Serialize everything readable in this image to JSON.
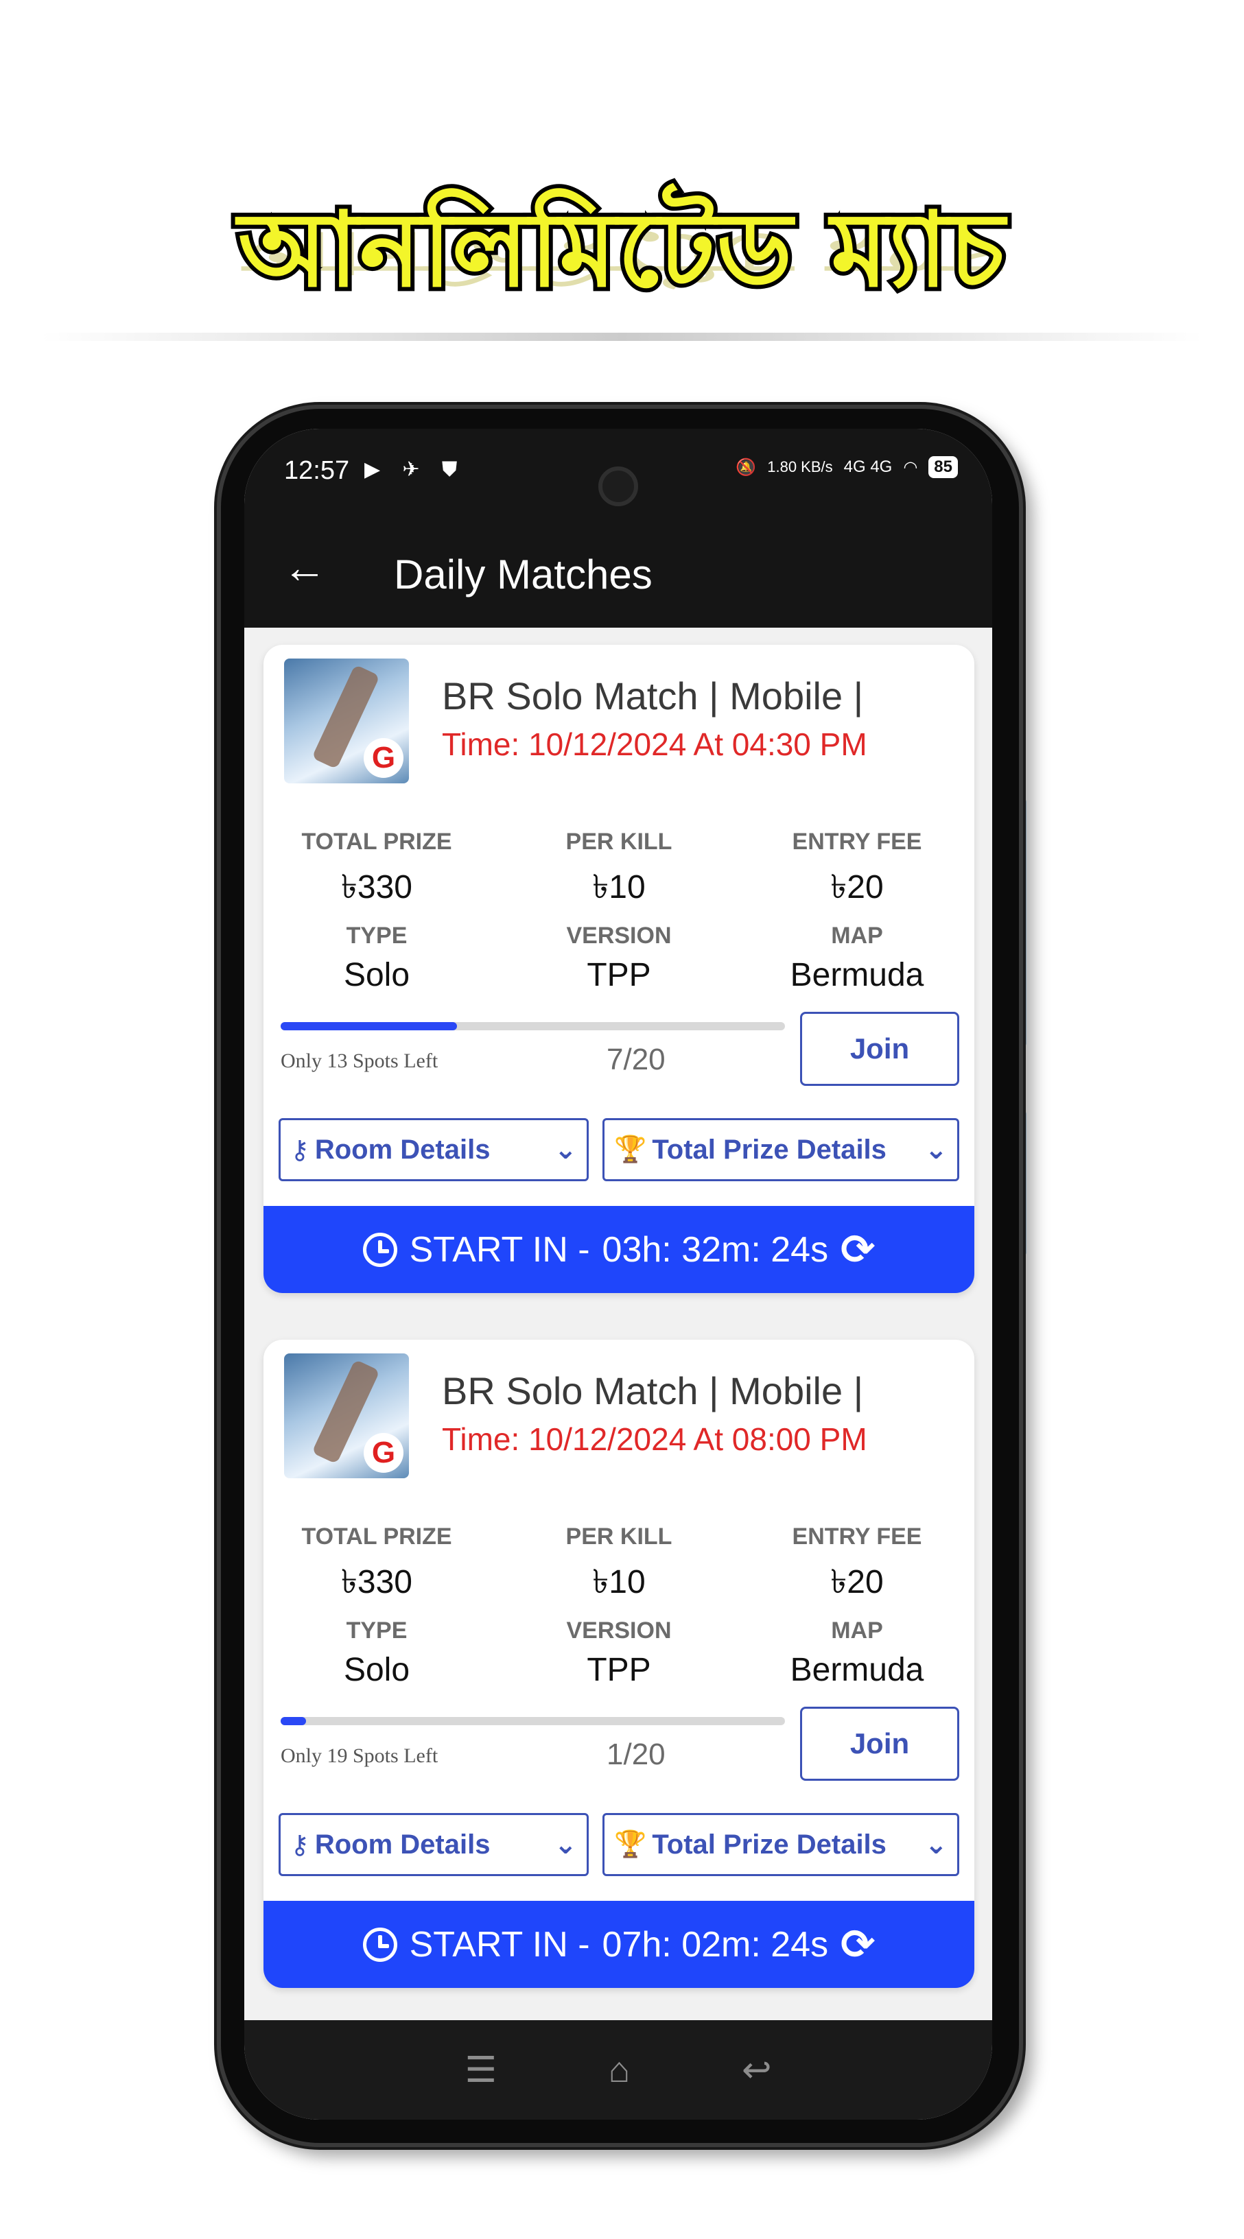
{
  "banner": {
    "title": "আনলিমিটেড ম্যাচ"
  },
  "status_bar": {
    "time": "12:57",
    "left_icons": "▶ ✈ ⛊",
    "speed": "1.80 KB/s",
    "network": "4G 4G",
    "battery": "85"
  },
  "app_bar": {
    "back_icon": "←",
    "title": "Daily Matches"
  },
  "labels": {
    "total_prize": "TOTAL PRIZE",
    "per_kill": "PER KILL",
    "entry_fee": "ENTRY FEE",
    "type": "TYPE",
    "version": "VERSION",
    "map": "MAP",
    "join": "Join",
    "room_details": "Room Details",
    "total_prize_details": "Total Prize Details",
    "start_in": "START IN -"
  },
  "matches": [
    {
      "name": "BR Solo Match | Mobile |",
      "time": "Time: 10/12/2024 At 04:30 PM",
      "total_prize": "৳330",
      "per_kill": "৳10",
      "entry_fee": "৳20",
      "type": "Solo",
      "version": "TPP",
      "map": "Bermuda",
      "joined": 7,
      "capacity": 20,
      "spots_left": "Only 13 Spots Left",
      "count": "7/20",
      "countdown": "03h: 32m: 24s"
    },
    {
      "name": "BR Solo Match | Mobile |",
      "time": "Time: 10/12/2024 At 08:00 PM",
      "total_prize": "৳330",
      "per_kill": "৳10",
      "entry_fee": "৳20",
      "type": "Solo",
      "version": "TPP",
      "map": "Bermuda",
      "joined": 1,
      "capacity": 20,
      "spots_left": "Only 19 Spots Left",
      "count": "1/20",
      "countdown": "07h: 02m: 24s"
    }
  ],
  "icons": {
    "key": "key-icon",
    "trophy": "trophy-icon",
    "chevron": "chevron-down-icon",
    "clock": "clock-icon",
    "refresh": "refresh-icon"
  },
  "nav_bar": {
    "menu": "☰",
    "home": "⌂",
    "back": "↩"
  },
  "colors": {
    "accent": "#1f46fb",
    "button_border": "#3c52b6",
    "time_red": "#e02828",
    "banner_yellow": "#f3f52a"
  }
}
